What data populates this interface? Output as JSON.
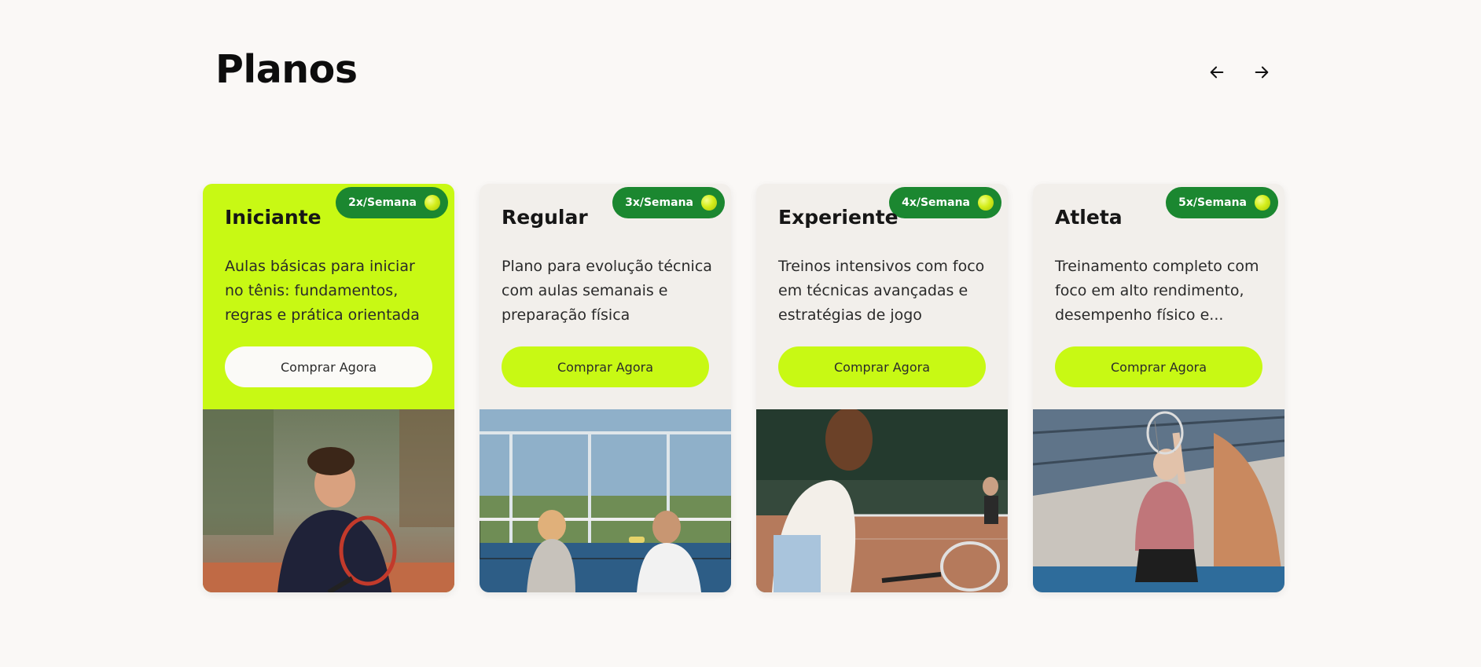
{
  "header": {
    "title": "Planos",
    "prev_icon": "arrow-left-icon",
    "next_icon": "arrow-right-icon"
  },
  "colors": {
    "accent": "#c8f914",
    "badge": "#1b8730",
    "card": "#f2efeb",
    "background": "#faf8f6"
  },
  "plans": [
    {
      "name": "Iniciante",
      "frequency": "2x/Semana",
      "description": "Aulas básicas para iniciar no tênis: fundamentos, regras e prática orientada",
      "button": "Comprar Agora",
      "featured": true,
      "photo": "man-with-tennis-racket-photo"
    },
    {
      "name": "Regular",
      "frequency": "3x/Semana",
      "description": "Plano para evolução técnica com aulas semanais e preparação física",
      "button": "Comprar Agora",
      "featured": false,
      "photo": "padel-players-resting-photo"
    },
    {
      "name": "Experiente",
      "frequency": "4x/Semana",
      "description": "Treinos intensivos com foco em técnicas avançadas e estratégias de jogo",
      "button": "Comprar Agora",
      "featured": false,
      "photo": "woman-ready-to-return-photo"
    },
    {
      "name": "Atleta",
      "frequency": "5x/Semana",
      "description": "Treinamento completo com foco em alto rendimento, desempenho físico e...",
      "button": "Comprar Agora",
      "featured": false,
      "photo": "player-serving-indoor-photo"
    }
  ]
}
